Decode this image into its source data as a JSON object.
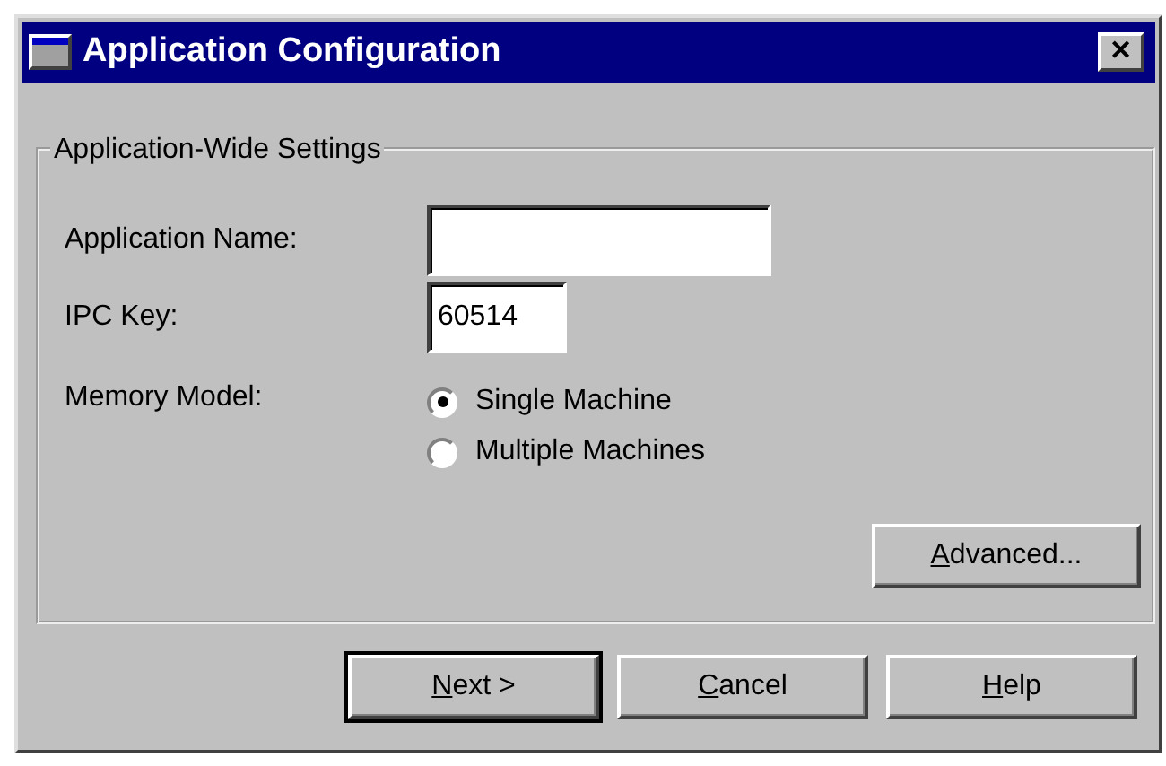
{
  "window": {
    "title": "Application Configuration",
    "close_glyph": "✕"
  },
  "group": {
    "title": "Application-Wide Settings",
    "fields": [
      {
        "label": "Application Name:",
        "kind": "wide"
      },
      {
        "label": "IPC Key:",
        "value": "60514",
        "kind": "narrow"
      }
    ],
    "memory_model": {
      "label": "Memory Model:",
      "options": [
        {
          "label": "Single Machine",
          "selected": true
        },
        {
          "label": "Multiple Machines",
          "selected": false
        }
      ]
    },
    "advanced_button": {
      "mnemonic": "A",
      "rest": "dvanced...",
      "default": false
    }
  },
  "buttons": [
    {
      "mnemonic": "N",
      "rest": "ext >",
      "default": true
    },
    {
      "mnemonic": "C",
      "rest": "ancel",
      "default": false
    },
    {
      "mnemonic": "H",
      "rest": "elp",
      "default": false
    }
  ]
}
